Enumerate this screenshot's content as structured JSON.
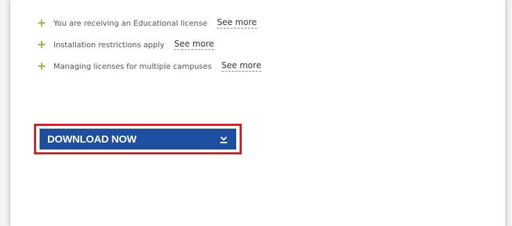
{
  "license_info": {
    "items": [
      {
        "text": "You are receiving an Educational license",
        "link": "See more"
      },
      {
        "text": "Installation restrictions apply",
        "link": "See more"
      },
      {
        "text": "Managing licenses for multiple campuses",
        "link": "See more"
      }
    ]
  },
  "download": {
    "label": "DOWNLOAD NOW",
    "icon": "download-chevron-icon",
    "button_color": "#1d4e9f",
    "highlight_color": "#e3131b"
  },
  "colors": {
    "plus_icon": "#8bbd3b",
    "link_underline": "#6a8bb3"
  }
}
